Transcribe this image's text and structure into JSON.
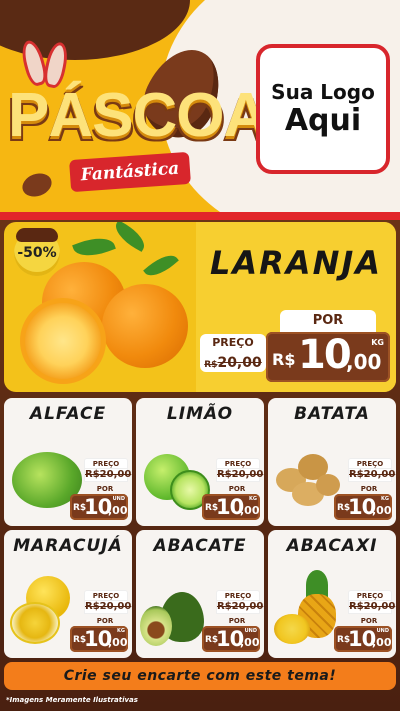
{
  "header": {
    "title": "PÁSCOA",
    "subtitle": "Fantástica",
    "logo_line1": "Sua Logo",
    "logo_line2": "Aqui"
  },
  "featured": {
    "discount": "-50%",
    "name": "LARANJA",
    "old_label": "PREÇO",
    "old_currency": "R$",
    "old_price": "20,00",
    "por_label": "POR",
    "currency": "R$",
    "price_int": "10",
    "price_cents": ",00",
    "unit": "KG"
  },
  "products": [
    {
      "name": "ALFACE",
      "old_label": "PREÇO",
      "old_price": "R$20,00",
      "por_label": "POR",
      "currency": "R$",
      "price_int": "10",
      "price_cents": ",00",
      "unit": "UND"
    },
    {
      "name": "LIMÃO",
      "old_label": "PREÇO",
      "old_price": "R$20,00",
      "por_label": "POR",
      "currency": "R$",
      "price_int": "10",
      "price_cents": ",00",
      "unit": "KG"
    },
    {
      "name": "BATATA",
      "old_label": "PREÇO",
      "old_price": "R$20,00",
      "por_label": "POR",
      "currency": "R$",
      "price_int": "10",
      "price_cents": ",00",
      "unit": "KG"
    },
    {
      "name": "MARACUJÁ",
      "old_label": "PREÇO",
      "old_price": "R$20,00",
      "por_label": "POR",
      "currency": "R$",
      "price_int": "10",
      "price_cents": ",00",
      "unit": "KG"
    },
    {
      "name": "ABACATE",
      "old_label": "PREÇO",
      "old_price": "R$20,00",
      "por_label": "POR",
      "currency": "R$",
      "price_int": "10",
      "price_cents": ",00",
      "unit": "UND"
    },
    {
      "name": "ABACAXI",
      "old_label": "PREÇO",
      "old_price": "R$20,00",
      "por_label": "POR",
      "currency": "R$",
      "price_int": "10",
      "price_cents": ",00",
      "unit": "UND"
    }
  ],
  "cta": "Crie seu encarte com este tema!",
  "disclaimer": "*Imagens Meramente Ilustrativas",
  "colors": {
    "brand_yellow": "#f3c21a",
    "chocolate": "#7a3a1c",
    "accent_red": "#d8262c",
    "cta_orange": "#f37d1b"
  }
}
